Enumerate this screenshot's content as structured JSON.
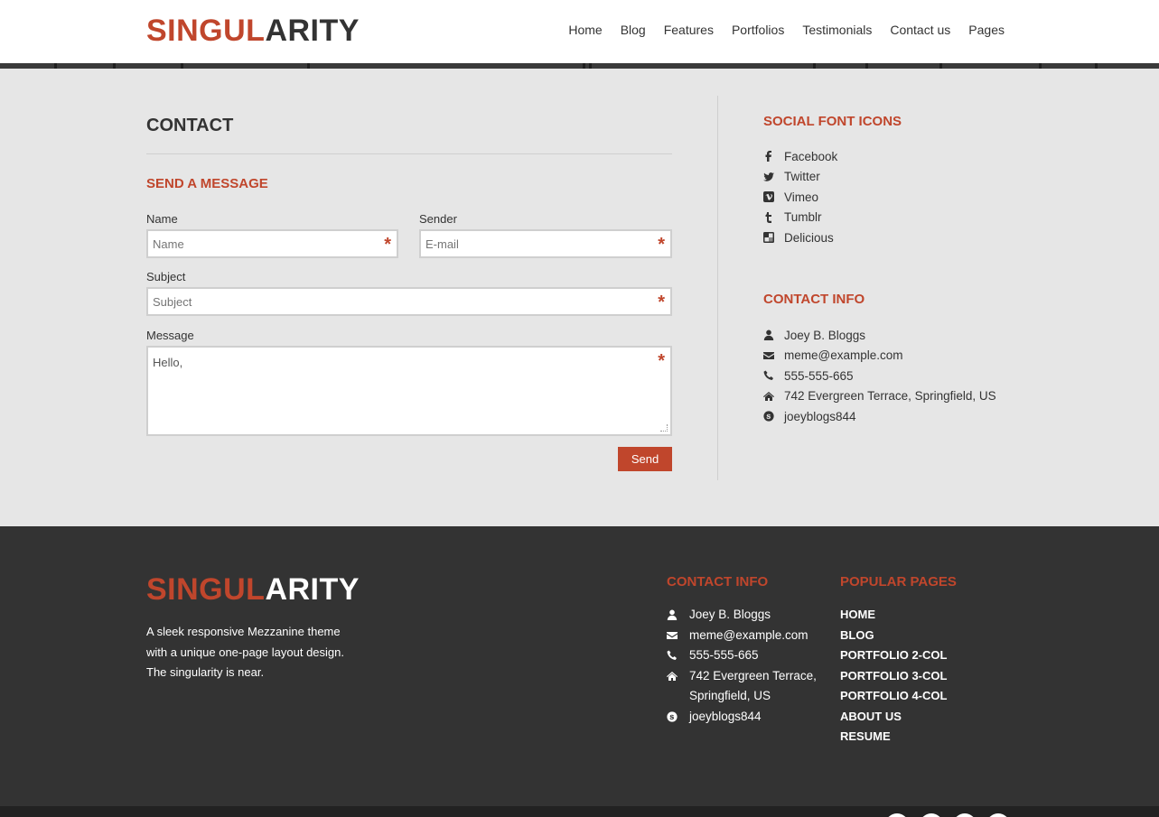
{
  "brand": {
    "part1": "SINGUL",
    "part2": "ARITY"
  },
  "nav": [
    {
      "label": "Home"
    },
    {
      "label": "Blog"
    },
    {
      "label": "Features"
    },
    {
      "label": "Portfolios"
    },
    {
      "label": "Testimonials"
    },
    {
      "label": "Contact us"
    },
    {
      "label": "Pages"
    }
  ],
  "page": {
    "title": "CONTACT",
    "send_message_title": "SEND A MESSAGE",
    "form": {
      "name": {
        "label": "Name",
        "placeholder": "Name",
        "required": "*"
      },
      "sender": {
        "label": "Sender",
        "placeholder": "E-mail",
        "required": "*"
      },
      "subject": {
        "label": "Subject",
        "placeholder": "Subject",
        "required": "*"
      },
      "message": {
        "label": "Message",
        "value": "Hello,",
        "required": "*"
      },
      "send_label": "Send"
    }
  },
  "sidebar": {
    "social_title": "SOCIAL FONT ICONS",
    "social": [
      {
        "label": "Facebook",
        "icon": "facebook-icon"
      },
      {
        "label": "Twitter",
        "icon": "twitter-icon"
      },
      {
        "label": "Vimeo",
        "icon": "vimeo-icon"
      },
      {
        "label": "Tumblr",
        "icon": "tumblr-icon"
      },
      {
        "label": "Delicious",
        "icon": "delicious-icon"
      }
    ],
    "contact_title": "CONTACT INFO",
    "contact": [
      {
        "label": "Joey B. Bloggs",
        "icon": "user-icon"
      },
      {
        "label": "meme@example.com",
        "icon": "envelope-icon"
      },
      {
        "label": "555-555-665",
        "icon": "phone-icon"
      },
      {
        "label": "742 Evergreen Terrace, Springfield, US",
        "icon": "home-icon"
      },
      {
        "label": "joeyblogs844",
        "icon": "skype-icon"
      }
    ]
  },
  "footer": {
    "description": "A sleek responsive Mezzanine theme with a unique one-page layout design. The singularity is near.",
    "contact_title": "CONTACT INFO",
    "contact": [
      {
        "label": "Joey B. Bloggs",
        "icon": "user-icon"
      },
      {
        "label": "meme@example.com",
        "icon": "envelope-icon"
      },
      {
        "label": "555-555-665",
        "icon": "phone-icon"
      },
      {
        "label": "742 Evergreen Terrace, Springfield, US",
        "icon": "home-icon"
      },
      {
        "label": "joeyblogs844",
        "icon": "skype-icon"
      }
    ],
    "popular_title": "POPULAR PAGES",
    "popular": [
      {
        "label": "HOME"
      },
      {
        "label": "BLOG"
      },
      {
        "label": "PORTFOLIO 2-COL"
      },
      {
        "label": "PORTFOLIO 3-COL"
      },
      {
        "label": "PORTFOLIO 4-COL"
      },
      {
        "label": "ABOUT US"
      },
      {
        "label": "RESUME"
      }
    ]
  },
  "colors": {
    "accent": "#c0462c",
    "dark": "#333333",
    "background": "#e6e6e6"
  }
}
